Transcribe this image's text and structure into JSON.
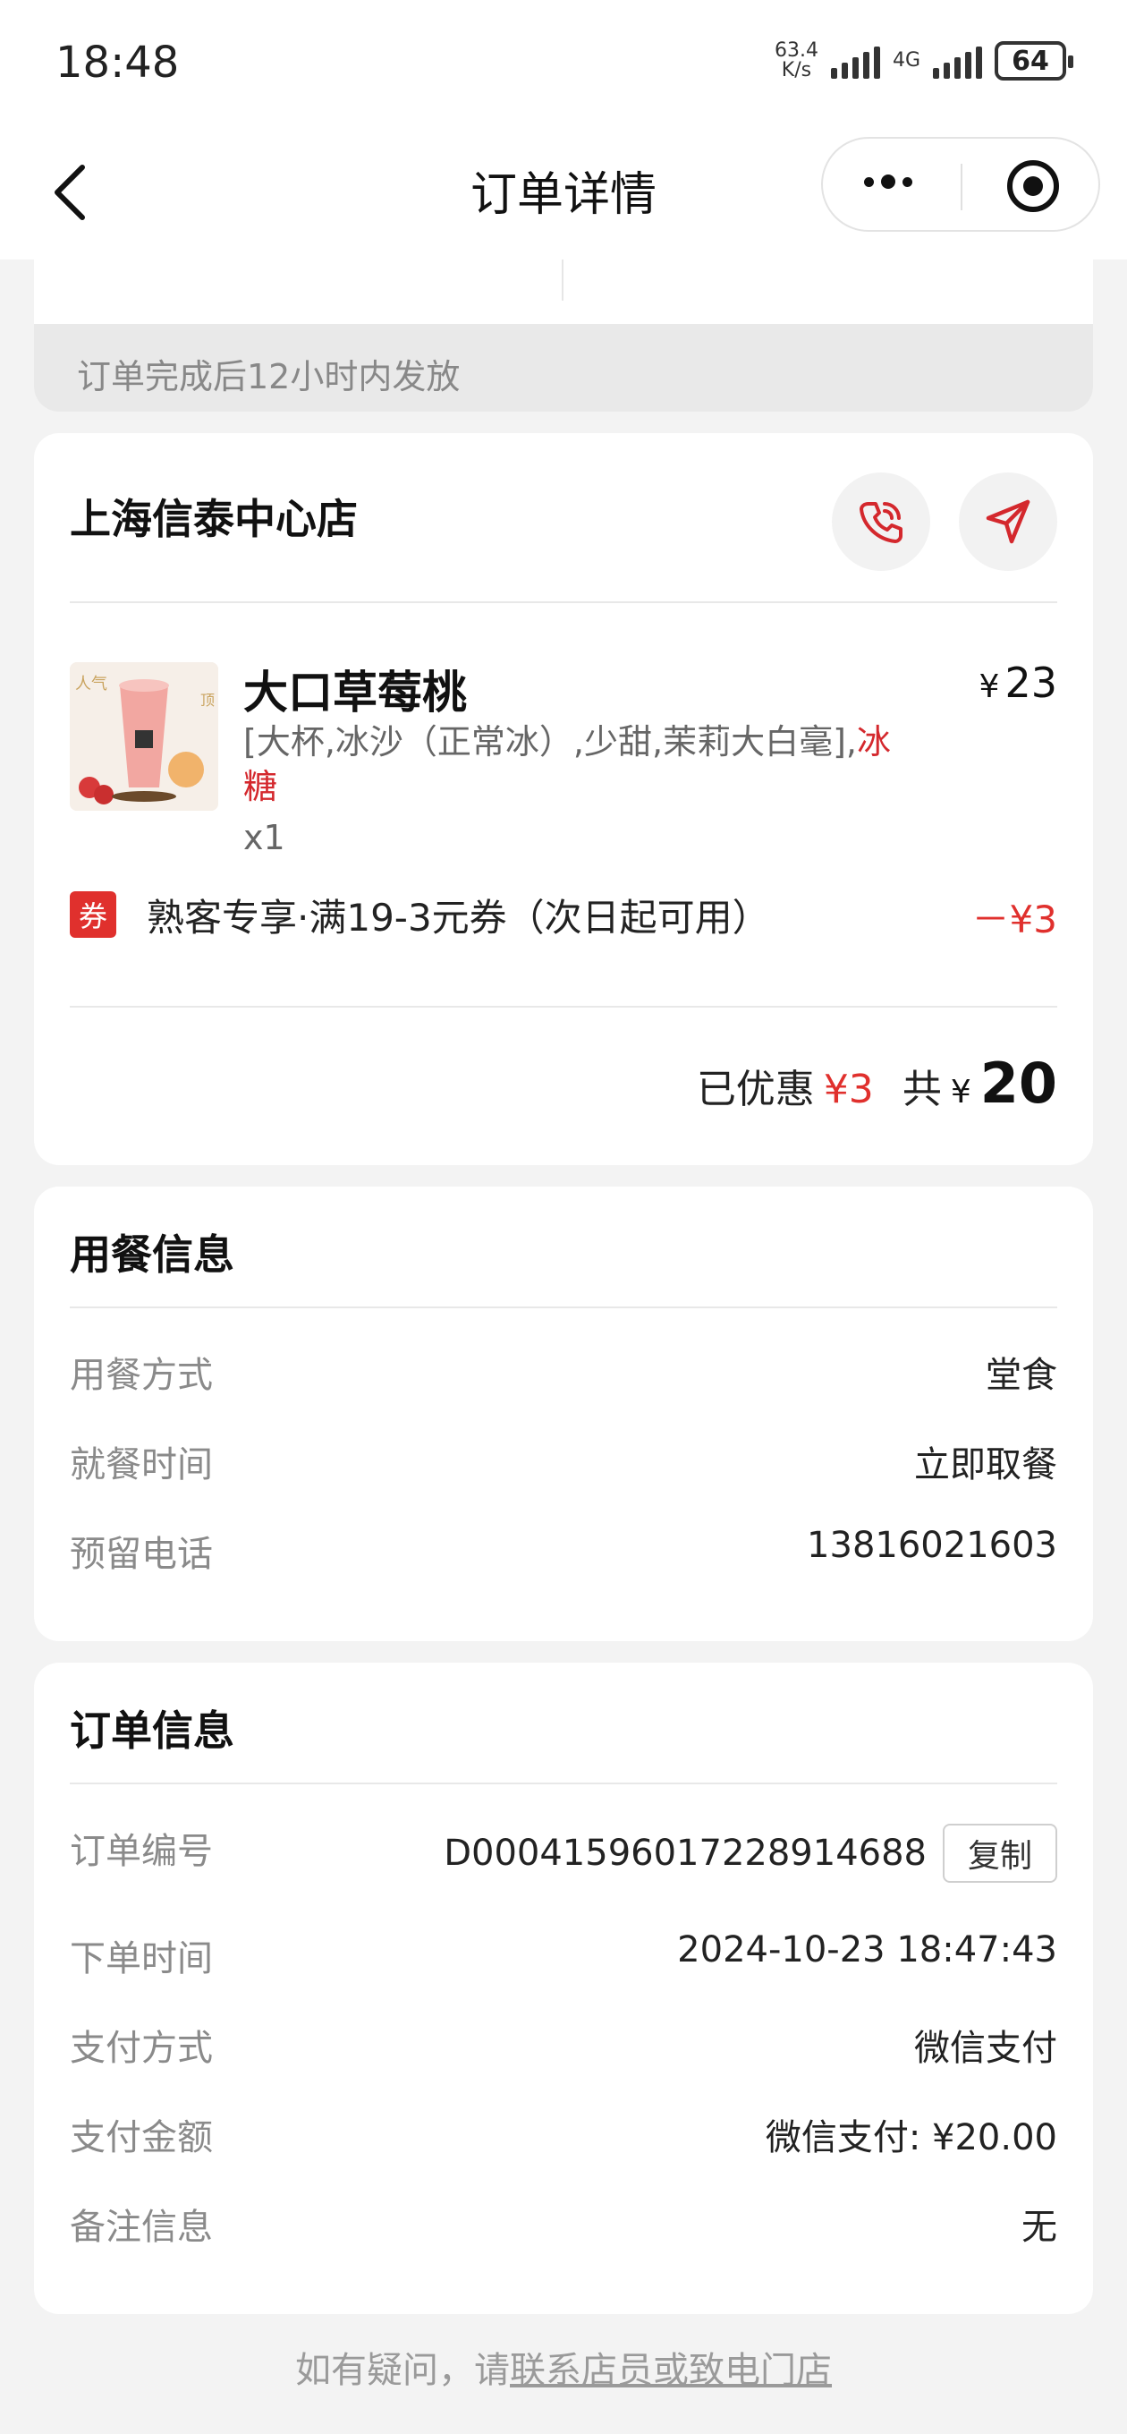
{
  "status_bar": {
    "time": "18:48",
    "net_speed_value": "63.4",
    "net_speed_unit": "K/s",
    "network_type": "4G",
    "battery": "64"
  },
  "nav": {
    "title": "订单详情",
    "icons": {
      "back": "chevron-left-icon",
      "more": "more-dots-icon",
      "close": "target-circle-icon"
    }
  },
  "notice": "订单完成后12小时内发放",
  "store": {
    "name": "上海信泰中心店",
    "icons": {
      "call": "phone-icon",
      "navigate": "navigation-arrow-icon"
    },
    "accent": "#d4282d"
  },
  "product": {
    "name": "大口草莓桃",
    "currency": "¥",
    "price": "23",
    "spec_main": "[大杯,冰沙（正常冰）,少甜,茉莉大白毫],",
    "spec_highlight": "冰糖",
    "qty": "x1",
    "image_badge_left": "人气",
    "image_badge_right": "顶"
  },
  "coupon": {
    "tag": "券",
    "text": "熟客专享·满19-3元券（次日起可用）",
    "amount": "－¥3"
  },
  "summary": {
    "discount_label": "已优惠",
    "discount_value": "¥3",
    "total_label": "共",
    "currency": "¥",
    "total_value": "20"
  },
  "dining": {
    "title": "用餐信息",
    "rows": [
      {
        "label": "用餐方式",
        "value": "堂食"
      },
      {
        "label": "就餐时间",
        "value": "立即取餐"
      },
      {
        "label": "预留电话",
        "value": "13816021603"
      }
    ]
  },
  "order": {
    "title": "订单信息",
    "copy_label": "复制",
    "rows": [
      {
        "label": "订单编号",
        "value": "D0004159601722891468​8"
      },
      {
        "label": "下单时间",
        "value": "2024-10-23 18:47:43"
      },
      {
        "label": "支付方式",
        "value": "微信支付"
      },
      {
        "label": "支付金额",
        "value": "微信支付: ¥20.00"
      },
      {
        "label": "备注信息",
        "value": "无"
      }
    ]
  },
  "footer": {
    "prefix": "如有疑问，请",
    "link": "联系店员或致电门店"
  }
}
